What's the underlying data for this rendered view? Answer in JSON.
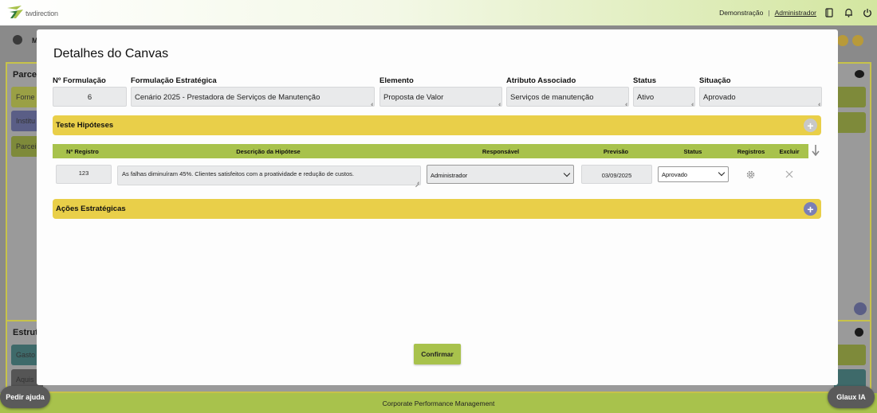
{
  "topbar": {
    "brand": "twdirection",
    "environment": "Demonstração",
    "separator": "|",
    "user": "Administrador",
    "icons": [
      "book-icon",
      "bell-icon",
      "power-icon"
    ]
  },
  "background": {
    "panel_top_title": "Parcei",
    "panel_top_items": [
      "Forne",
      "Institu",
      "Parcei"
    ],
    "panel_bottom_title": "Estrutu",
    "panel_bottom_items": [
      "Gasto",
      "Aquis"
    ],
    "header_initial": "M"
  },
  "modal": {
    "title": "Detalhes do Canvas",
    "fields": {
      "formulacao_num": {
        "label": "Nº Formulação",
        "value": "6"
      },
      "formulacao_estrategica": {
        "label": "Formulação Estratégica",
        "value": "Cenário 2025 - Prestadora de Serviços de Manutenção"
      },
      "elemento": {
        "label": "Elemento",
        "value": "Proposta de Valor"
      },
      "atributo": {
        "label": "Atributo Associado",
        "value": "Serviços de manutenção"
      },
      "status": {
        "label": "Status",
        "value": "Ativo"
      },
      "situacao": {
        "label": "Situação",
        "value": "Aprovado"
      }
    },
    "hipoteses": {
      "title": "Teste Hipóteses",
      "columns": {
        "registro": "Nº Registro",
        "descricao": "Descrição da Hipótese",
        "responsavel": "Responsável",
        "previsao": "Previsão",
        "status": "Status",
        "registros": "Registros",
        "excluir": "Excluir"
      },
      "rows": [
        {
          "registro": "123",
          "descricao": "As falhas diminuíram 45%. Clientes satisfeitos com a proatividade e redução de custos.",
          "responsavel": "Administrador",
          "previsao": "03/09/2025",
          "status": "Aprovado"
        }
      ]
    },
    "acoes": {
      "title": "Ações Estratégicas"
    },
    "confirm_label": "Confirmar"
  },
  "bottombar": {
    "label": "Corporate Performance Management",
    "help_label": "Pedir ajuda",
    "ai_label": "Glaux IA"
  },
  "colors": {
    "accent_green": "#a8c24c",
    "accent_yellow": "#e9cf49",
    "add_purple": "#7b7fb5",
    "add_grey": "#c8c8c8"
  }
}
